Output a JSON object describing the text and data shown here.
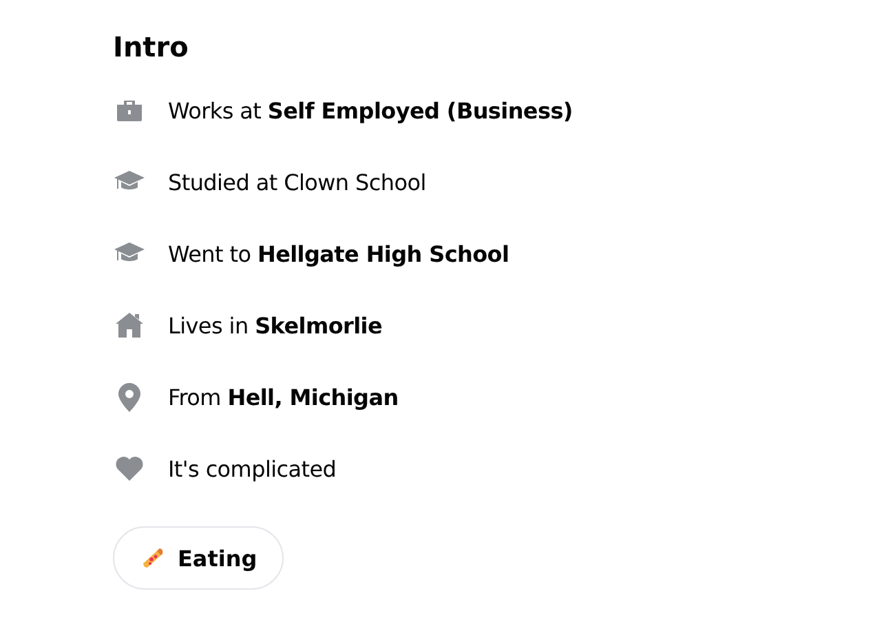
{
  "title": "Intro",
  "items": [
    {
      "kind": "work",
      "text": "Works at **Self Employed (Business)**"
    },
    {
      "kind": "school",
      "text": "Studied at Clown School"
    },
    {
      "kind": "school",
      "text": "Went to **Hellgate High School**"
    },
    {
      "kind": "home",
      "text": "Lives in **Skelmorlie**"
    },
    {
      "kind": "place",
      "text": "From **Hell, Michigan**"
    },
    {
      "kind": "heart",
      "text": "It's complicated"
    }
  ],
  "hobbies": [
    {
      "label": "Eating"
    }
  ]
}
